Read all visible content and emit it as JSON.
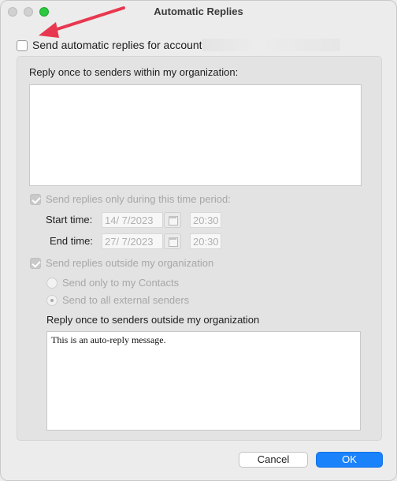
{
  "window": {
    "title": "Automatic Replies"
  },
  "main": {
    "send_auto_label": "Send automatic replies for account",
    "send_auto_checked": false
  },
  "inside": {
    "heading": "Reply once to senders within my organization:",
    "message": ""
  },
  "time_period": {
    "label": "Send replies only during this time period:",
    "checked": true,
    "start_label": "Start time:",
    "start_date": "14/  7/2023",
    "start_time": "20:30",
    "end_label": "End time:",
    "end_date": "27/  7/2023",
    "end_time": "20:30"
  },
  "outside": {
    "label": "Send replies outside my organization",
    "checked": true,
    "option_contacts": "Send only to my Contacts",
    "option_all": "Send to all external senders",
    "selected": "Send to all external senders",
    "heading": "Reply once to senders outside my organization",
    "message": "This is an auto-reply message."
  },
  "buttons": {
    "cancel": "Cancel",
    "ok": "OK"
  },
  "colors": {
    "accent": "#1a82fb",
    "arrow": "#e8384f",
    "zoom": "#2bc840"
  },
  "icons": [
    "close-icon",
    "minimize-icon",
    "zoom-icon",
    "calendar-icon",
    "arrow-annotation-icon"
  ]
}
